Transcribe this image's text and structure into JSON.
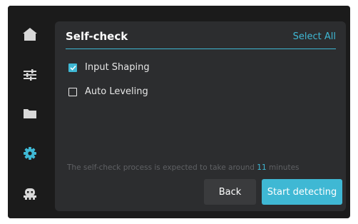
{
  "sidebar": {
    "items": [
      {
        "icon": "home-icon"
      },
      {
        "icon": "sliders-icon"
      },
      {
        "icon": "folder-icon"
      },
      {
        "icon": "gear-icon",
        "active": true
      },
      {
        "icon": "robot-icon"
      }
    ],
    "icon_color": "#d9d9d9",
    "active_color": "#3fb8d4"
  },
  "panel": {
    "title": "Self-check",
    "select_all_label": "Select All",
    "options": [
      {
        "label": "Input Shaping",
        "checked": true
      },
      {
        "label": "Auto Leveling",
        "checked": false
      }
    ],
    "info_prefix": "The self-check process is expected to take around ",
    "info_minutes": "11",
    "info_suffix": " minutes",
    "back_label": "Back",
    "start_label": "Start detecting"
  },
  "colors": {
    "accent": "#3fb8d4",
    "panel_bg": "#2c2d2f",
    "device_bg": "#1b1b1b"
  }
}
